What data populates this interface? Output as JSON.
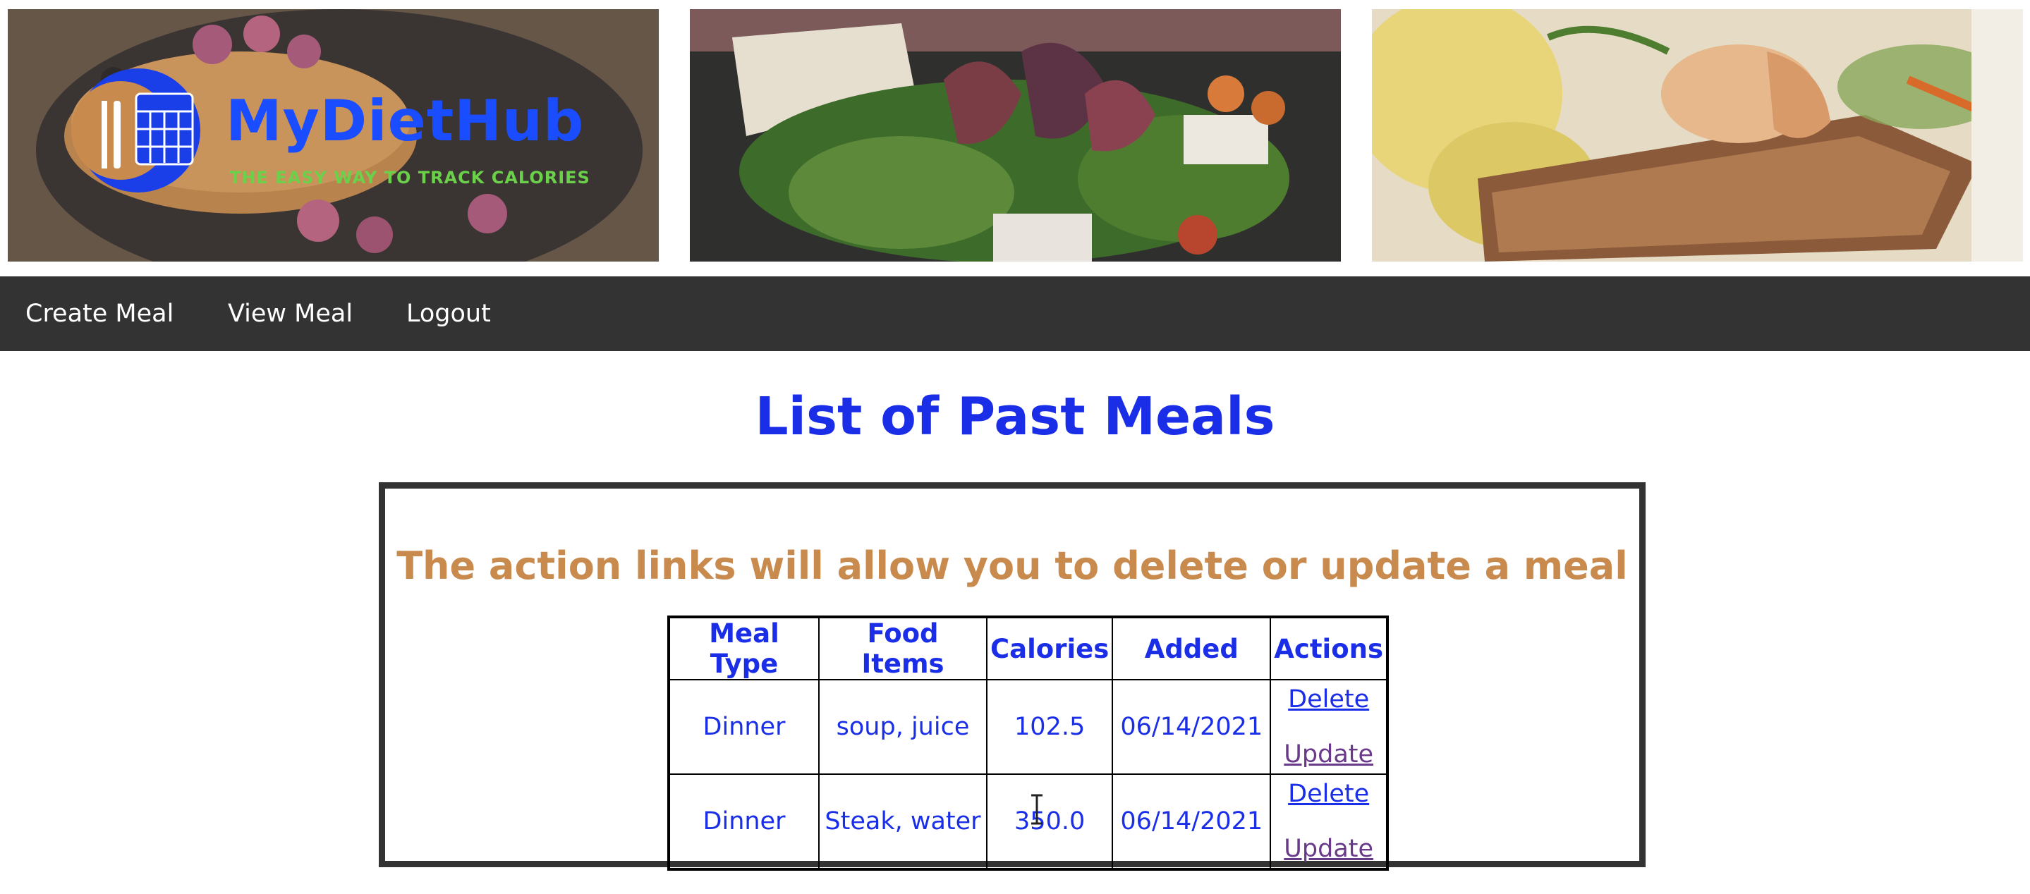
{
  "brand": {
    "name": "MyDietHub",
    "tagline": "THE EASY WAY TO TRACK CALORIES",
    "logo_icon": "calendar-fork-knife-icon"
  },
  "banner_images": [
    "pancakes-raspberries-photo",
    "fig-salad-cheese-photo",
    "fish-shrimp-plate-photo"
  ],
  "nav": {
    "items": [
      {
        "label": "Create Meal"
      },
      {
        "label": "View Meal"
      },
      {
        "label": "Logout"
      }
    ]
  },
  "main": {
    "title": "List of Past Meals",
    "subtitle": "The action links will allow you to delete or update a meal",
    "table": {
      "headers": [
        "Meal Type",
        "Food Items",
        "Calories",
        "Added",
        "Actions"
      ],
      "rows": [
        {
          "meal_type": "Dinner",
          "food_items": "soup, juice",
          "calories": "102.5",
          "added": "06/14/2021",
          "delete": "Delete",
          "update": "Update"
        },
        {
          "meal_type": "Dinner",
          "food_items": "Steak, water",
          "calories": "350.0",
          "added": "06/14/2021",
          "delete": "Delete",
          "update": "Update"
        }
      ]
    }
  },
  "colors": {
    "nav_bg": "#333333",
    "title": "#1a2ee8",
    "subtitle": "#c98a4e",
    "visited_link": "#6a3a8a",
    "brand_blue": "#1a4dff",
    "brand_green": "#6bd04a"
  }
}
